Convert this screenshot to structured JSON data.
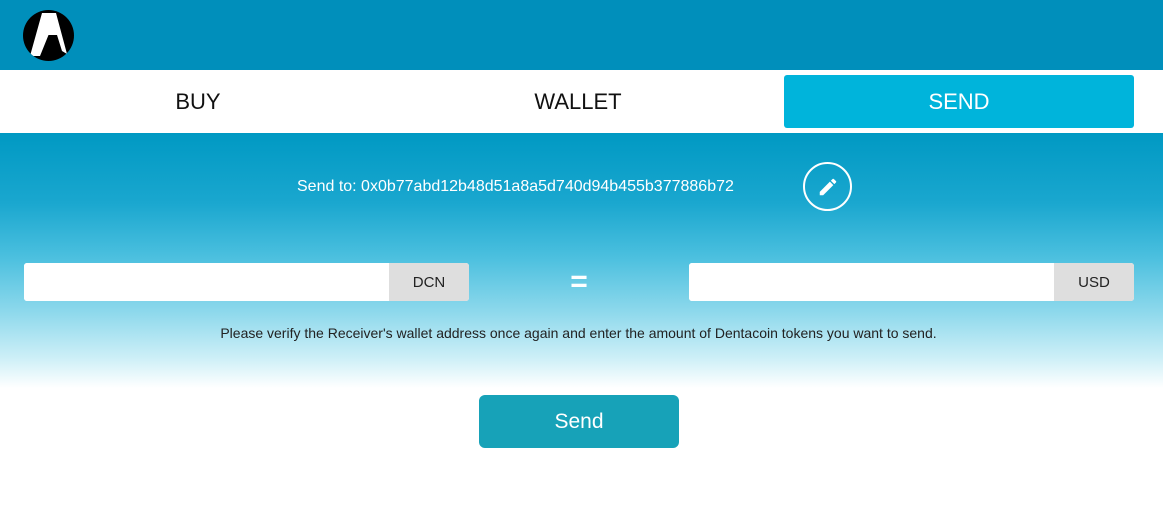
{
  "header": {
    "logo_icon": "dentacoin-logo-icon"
  },
  "tabs": [
    {
      "label": "BUY",
      "active": false
    },
    {
      "label": "WALLET",
      "active": false
    },
    {
      "label": "SEND",
      "active": true
    }
  ],
  "send": {
    "recipient_text": "Send to: 0x0b77abd12b48d51a8a5d740d94b455b377886b72",
    "edit_icon": "pencil-icon",
    "amount_dcn_value": "",
    "amount_dcn_unit": "DCN",
    "equals_sign": "=",
    "amount_usd_value": "",
    "amount_usd_unit": "USD",
    "info_text": "Please verify the Receiver's wallet address once again and enter the amount of Dentacoin tokens you want to send.",
    "send_button_label": "Send"
  },
  "colors": {
    "header_bg": "#008fbb",
    "active_tab_bg": "#00b4db",
    "send_button_bg": "#17a2b8",
    "unit_bg": "#dedede"
  }
}
